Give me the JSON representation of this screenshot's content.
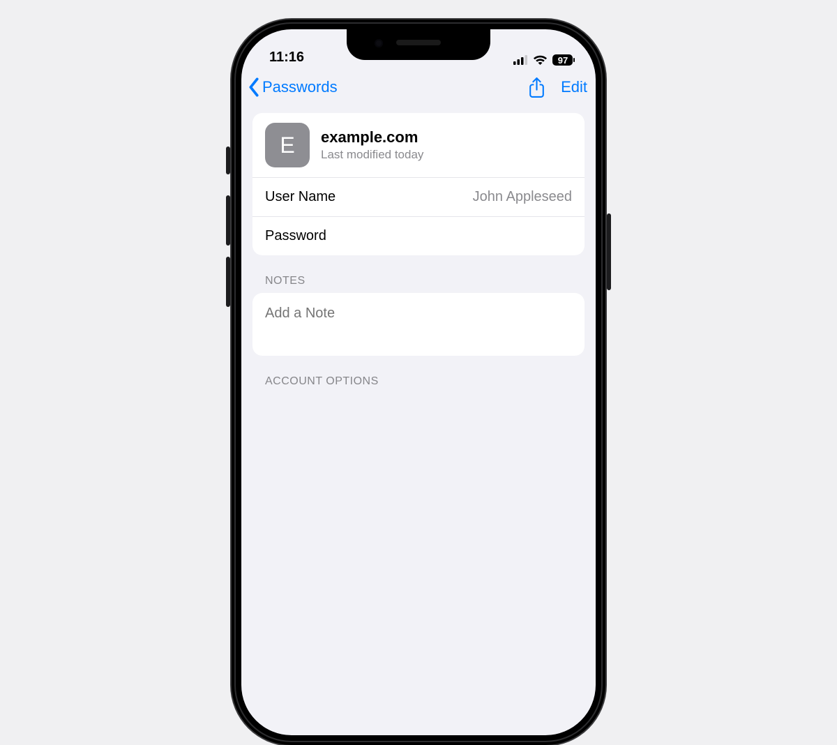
{
  "status": {
    "time": "11:16",
    "battery": "97"
  },
  "nav": {
    "back_label": "Passwords",
    "edit_label": "Edit"
  },
  "site": {
    "icon_letter": "E",
    "title": "example.com",
    "subtitle": "Last modified today"
  },
  "fields": {
    "username_label": "User Name",
    "username_value": "John Appleseed",
    "password_label": "Password",
    "password_value": ""
  },
  "sections": {
    "notes_header": "NOTES",
    "notes_placeholder": "Add a Note",
    "account_options_header": "ACCOUNT OPTIONS"
  }
}
